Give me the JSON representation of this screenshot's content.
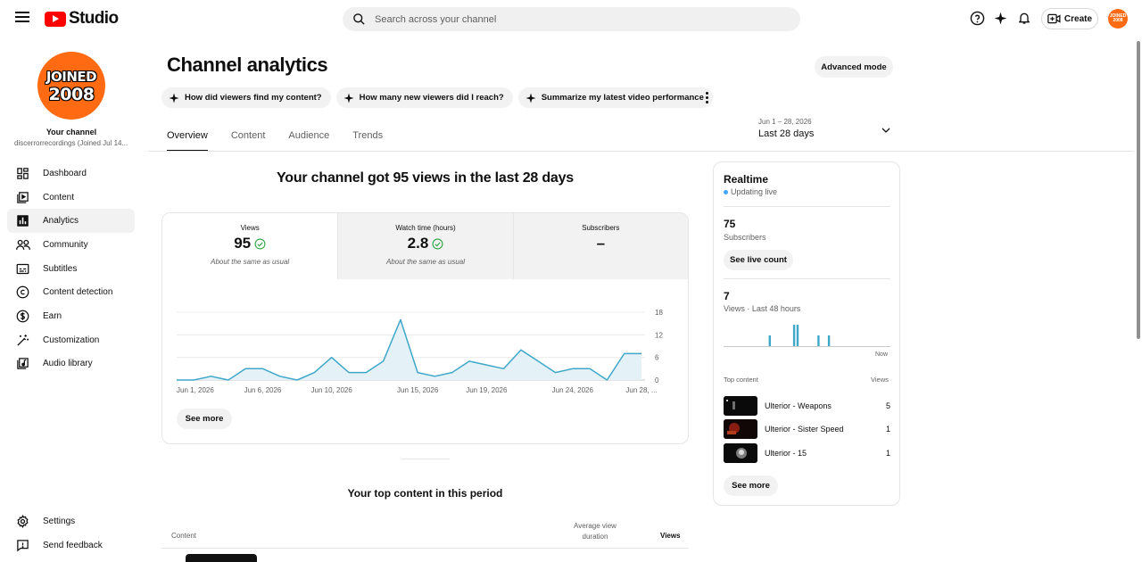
{
  "header": {
    "brand": "Studio",
    "search_placeholder": "Search across your channel",
    "create_label": "Create",
    "avatar_text": "JOINED 2008"
  },
  "sidebar": {
    "avatar_line1": "JOINED",
    "avatar_line2": "2008",
    "channel_label": "Your channel",
    "channel_name": "discerrorrecordings (Joined Jul 14...",
    "items": [
      {
        "label": "Dashboard",
        "icon": "dashboard-icon"
      },
      {
        "label": "Content",
        "icon": "content-icon"
      },
      {
        "label": "Analytics",
        "icon": "analytics-icon",
        "active": true
      },
      {
        "label": "Community",
        "icon": "community-icon"
      },
      {
        "label": "Subtitles",
        "icon": "subtitles-icon"
      },
      {
        "label": "Content detection",
        "icon": "copyright-icon"
      },
      {
        "label": "Earn",
        "icon": "dollar-icon"
      },
      {
        "label": "Customization",
        "icon": "magic-wand-icon"
      },
      {
        "label": "Audio library",
        "icon": "audio-library-icon"
      }
    ],
    "bottom": [
      {
        "label": "Settings",
        "icon": "gear-icon"
      },
      {
        "label": "Send feedback",
        "icon": "feedback-icon"
      }
    ]
  },
  "main": {
    "title": "Channel analytics",
    "advanced_mode": "Advanced mode",
    "chips": [
      "How did viewers find my content?",
      "How many new viewers did I reach?",
      "Summarize my latest video performance"
    ],
    "tabs": [
      "Overview",
      "Content",
      "Audience",
      "Trends"
    ],
    "date_range": "Jun 1 – 28, 2026",
    "date_label": "Last 28 days",
    "headline": "Your channel got 95 views in the last 28 days",
    "metrics": [
      {
        "label": "Views",
        "value": "95",
        "sub": "About the same as usual",
        "check": true
      },
      {
        "label": "Watch time (hours)",
        "value": "2.8",
        "sub": "About the same as usual",
        "check": true
      },
      {
        "label": "Subscribers",
        "value": "–",
        "sub": "",
        "check": false
      }
    ],
    "see_more": "See more",
    "top_content_title": "Your top content in this period",
    "table_headers": {
      "content": "Content",
      "avg_view_duration": "Average view duration",
      "views": "Views"
    }
  },
  "chart_data": {
    "type": "area",
    "x": [
      "Jun 1",
      "Jun 2",
      "Jun 3",
      "Jun 4",
      "Jun 5",
      "Jun 6",
      "Jun 7",
      "Jun 8",
      "Jun 9",
      "Jun 10",
      "Jun 11",
      "Jun 12",
      "Jun 13",
      "Jun 14",
      "Jun 15",
      "Jun 16",
      "Jun 17",
      "Jun 18",
      "Jun 19",
      "Jun 20",
      "Jun 21",
      "Jun 22",
      "Jun 23",
      "Jun 24",
      "Jun 25",
      "Jun 26",
      "Jun 27",
      "Jun 28"
    ],
    "series": [
      {
        "values": [
          0,
          0,
          1,
          0,
          3,
          3,
          1,
          0,
          2,
          6,
          2,
          2,
          5,
          16,
          2,
          1,
          2,
          5,
          4,
          3,
          8,
          5,
          2,
          3,
          3,
          0,
          7,
          7
        ]
      }
    ],
    "x_tick_labels": [
      "Jun 1, 2026",
      "Jun 6, 2026",
      "Jun 10, 2026",
      "Jun 15, 2026",
      "Jun 19, 2026",
      "Jun 24, 2026",
      "Jun 28, ..."
    ],
    "y_ticks": [
      "18",
      "12",
      "6",
      "0"
    ],
    "ylim": [
      0,
      18
    ],
    "color": "#3fa7c9",
    "fill": "#e4f2f8"
  },
  "realtime": {
    "title": "Realtime",
    "status": "Updating live",
    "subscribers_value": "75",
    "subscribers_label": "Subscribers",
    "see_live_count": "See live count",
    "views_value": "7",
    "views_label": "Views · Last 48 hours",
    "now_label": "Now",
    "bars": [
      {
        "hour": 13,
        "value": 1
      },
      {
        "hour": 20,
        "value": 2
      },
      {
        "hour": 21,
        "value": 2
      },
      {
        "hour": 27,
        "value": 1
      },
      {
        "hour": 30,
        "value": 1
      }
    ],
    "top_content_label": "Top content",
    "views_header": "Views",
    "top_content": [
      {
        "title": "Ulterior - Weapons",
        "views": "5"
      },
      {
        "title": "Ulterior - Sister Speed",
        "views": "1"
      },
      {
        "title": "Ulterior - 15",
        "views": "1"
      }
    ],
    "see_more": "See more",
    "bar_color": "#3fa7c9"
  }
}
